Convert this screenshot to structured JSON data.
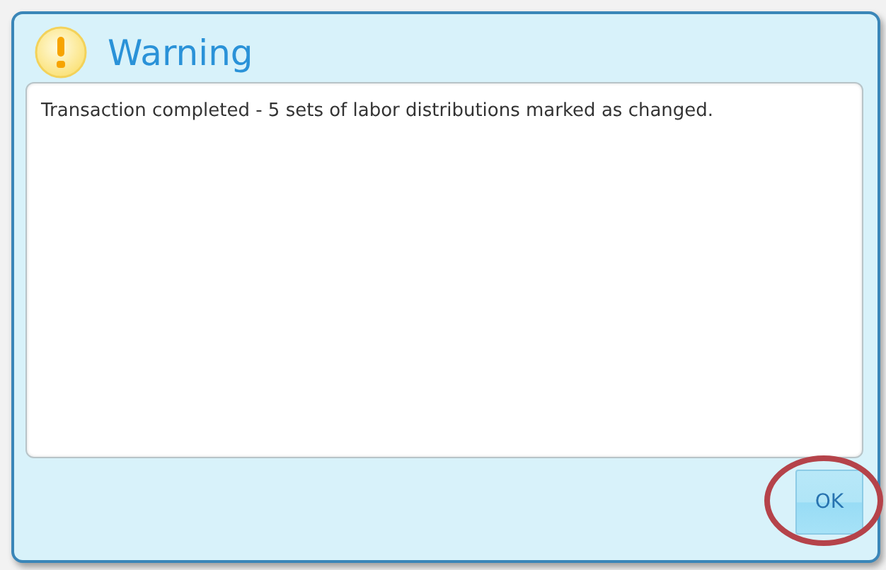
{
  "dialog": {
    "title": "Warning",
    "message": "Transaction completed - 5 sets of labor distributions marked as changed.",
    "buttons": [
      {
        "label": "OK",
        "circled": true
      }
    ]
  }
}
